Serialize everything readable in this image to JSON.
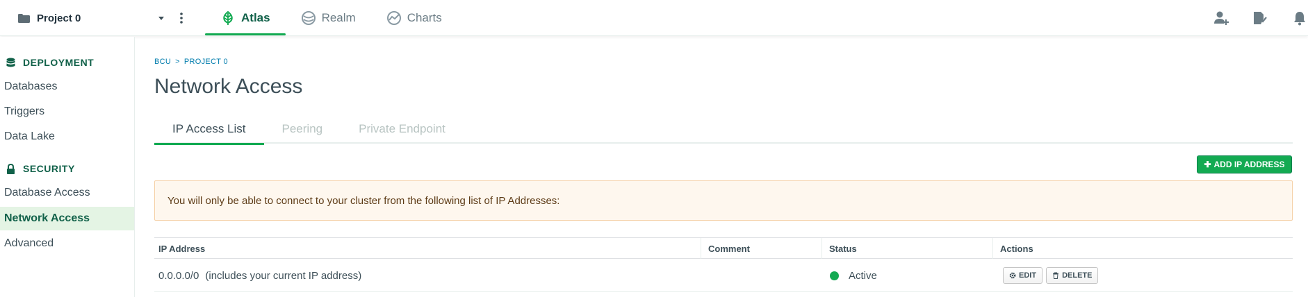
{
  "topbar": {
    "project_name": "Project 0",
    "products": [
      {
        "label": "Atlas",
        "icon": "leaf-icon",
        "active": true
      },
      {
        "label": "Realm",
        "icon": "realm-icon",
        "active": false
      },
      {
        "label": "Charts",
        "icon": "charts-icon",
        "active": false
      }
    ],
    "right_icons": [
      "invite-user-icon",
      "activity-icon",
      "bell-icon"
    ]
  },
  "sidebar": {
    "sections": [
      {
        "title": "DEPLOYMENT",
        "icon": "database-icon",
        "items": [
          "Databases",
          "Triggers",
          "Data Lake"
        ]
      },
      {
        "title": "SECURITY",
        "icon": "lock-icon",
        "items": [
          "Database Access",
          "Network Access",
          "Advanced"
        ]
      }
    ],
    "active_item": "Network Access"
  },
  "breadcrumb": {
    "org": "BCU",
    "separator": ">",
    "project": "PROJECT 0"
  },
  "page_title": "Network Access",
  "tabs": [
    "IP Access List",
    "Peering",
    "Private Endpoint"
  ],
  "active_tab": "IP Access List",
  "add_button_label": "ADD IP ADDRESS",
  "notice": "You will only be able to connect to your cluster from the following list of IP Addresses:",
  "table": {
    "columns": [
      "IP Address",
      "Comment",
      "Status",
      "Actions"
    ],
    "rows": [
      {
        "ip": "0.0.0.0/0",
        "note": "(includes your current IP address)",
        "comment": "",
        "status": "Active",
        "edit_label": "EDIT",
        "delete_label": "DELETE"
      }
    ]
  },
  "colors": {
    "accent": "#13aa52",
    "brand_dark": "#116149",
    "link": "#007cad"
  }
}
